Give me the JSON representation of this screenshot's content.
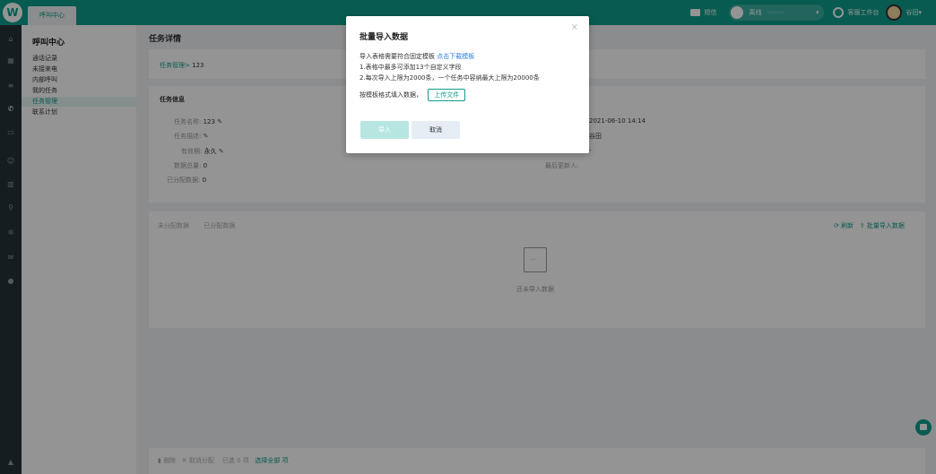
{
  "topbar": {
    "tab": "呼叫中心",
    "sms_label": "短信",
    "status_label": "离线",
    "status_time": "--:--:--",
    "workspace_label": "客服工作台",
    "user_name": "谷田"
  },
  "sidebar": {
    "title": "呼叫中心",
    "items": [
      {
        "label": "通话记录"
      },
      {
        "label": "未接来电"
      },
      {
        "label": "内部呼叫"
      },
      {
        "label": "我的任务"
      },
      {
        "label": "任务管理"
      },
      {
        "label": "联系计划"
      }
    ],
    "active_index": 4
  },
  "main": {
    "page_title": "任务详情",
    "breadcrumb": {
      "root": "任务管理",
      "sep": ">",
      "current": "123"
    },
    "info_heading": "任务信息",
    "fields": [
      {
        "label": "任务名称:",
        "value": "123",
        "editable": true
      },
      {
        "label": "任务描述:",
        "value": "",
        "editable": true
      },
      {
        "label": "有效期:",
        "value": "永久",
        "editable": true
      },
      {
        "label": "数据总量:",
        "value": "0",
        "editable": false
      },
      {
        "label": "已分配数据:",
        "value": "0",
        "editable": false
      }
    ],
    "right_fields": [
      {
        "label": "",
        "value": "2021-06-10 14:14"
      },
      {
        "label": "",
        "value": "谷田"
      },
      {
        "label": "",
        "value": "-"
      },
      {
        "label": "最后更新人:",
        "value": ""
      }
    ],
    "tabs": [
      "未分配数据",
      "已分配数据"
    ],
    "refresh_label": "刷新",
    "bulk_import_label": "批量导入数据",
    "empty_text": "还未导入数据",
    "footer": {
      "delete_label": "删除",
      "unassign_label": "取消分配",
      "selected_text": "已选 0 项",
      "select_all_label": "选择全部 项"
    }
  },
  "dialog": {
    "title": "批量导入数据",
    "close": "×",
    "line1_prefix": "导入表格需要符合固定模板",
    "line1_link": "点击下载模板",
    "line2": "1.表格中最多可添加13个自定义字段",
    "line3": "2.每次导入上限为2000条，一个任务中容纳最大上限为20000条",
    "line4_prefix": "按模板格式填入数据，",
    "upload_label": "上传文件",
    "import_label": "导入",
    "cancel_label": "取消"
  },
  "colors": {
    "brand": "#0e9e8a",
    "link": "#2a7ddb",
    "rail": "#263238"
  },
  "icons": [
    "home-icon",
    "grid-icon",
    "list-icon",
    "phone-icon",
    "chat-icon",
    "user-icon",
    "chart-icon",
    "search-icon",
    "settings-icon",
    "mail-icon",
    "info-icon",
    "lock-icon"
  ]
}
